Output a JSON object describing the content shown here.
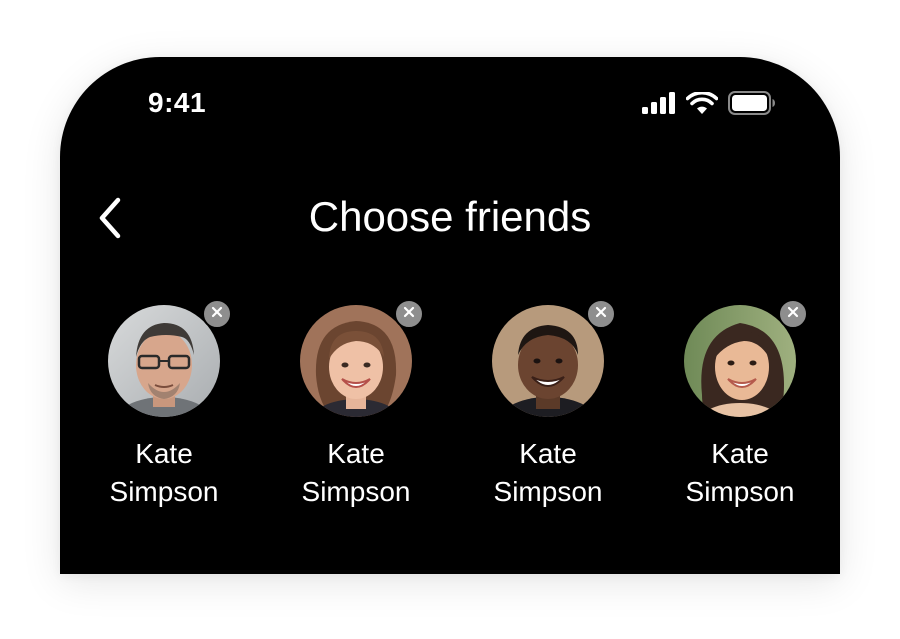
{
  "status_bar": {
    "time": "9:41",
    "signal_icon": "cellular-signal-icon",
    "wifi_icon": "wifi-icon",
    "battery_icon": "battery-icon"
  },
  "header": {
    "back_icon": "chevron-left-icon",
    "title": "Choose friends"
  },
  "friends": [
    {
      "first": "Kate",
      "last": "Simpson",
      "avatar": "man-glasses-photo"
    },
    {
      "first": "Kate",
      "last": "Simpson",
      "avatar": "older-woman-photo"
    },
    {
      "first": "Kate",
      "last": "Simpson",
      "avatar": "man-smiling-photo"
    },
    {
      "first": "Kate",
      "last": "Simpson",
      "avatar": "young-woman-photo"
    }
  ],
  "colors": {
    "background": "#000000",
    "text": "#ffffff",
    "remove_badge": "#8e8e8e"
  }
}
